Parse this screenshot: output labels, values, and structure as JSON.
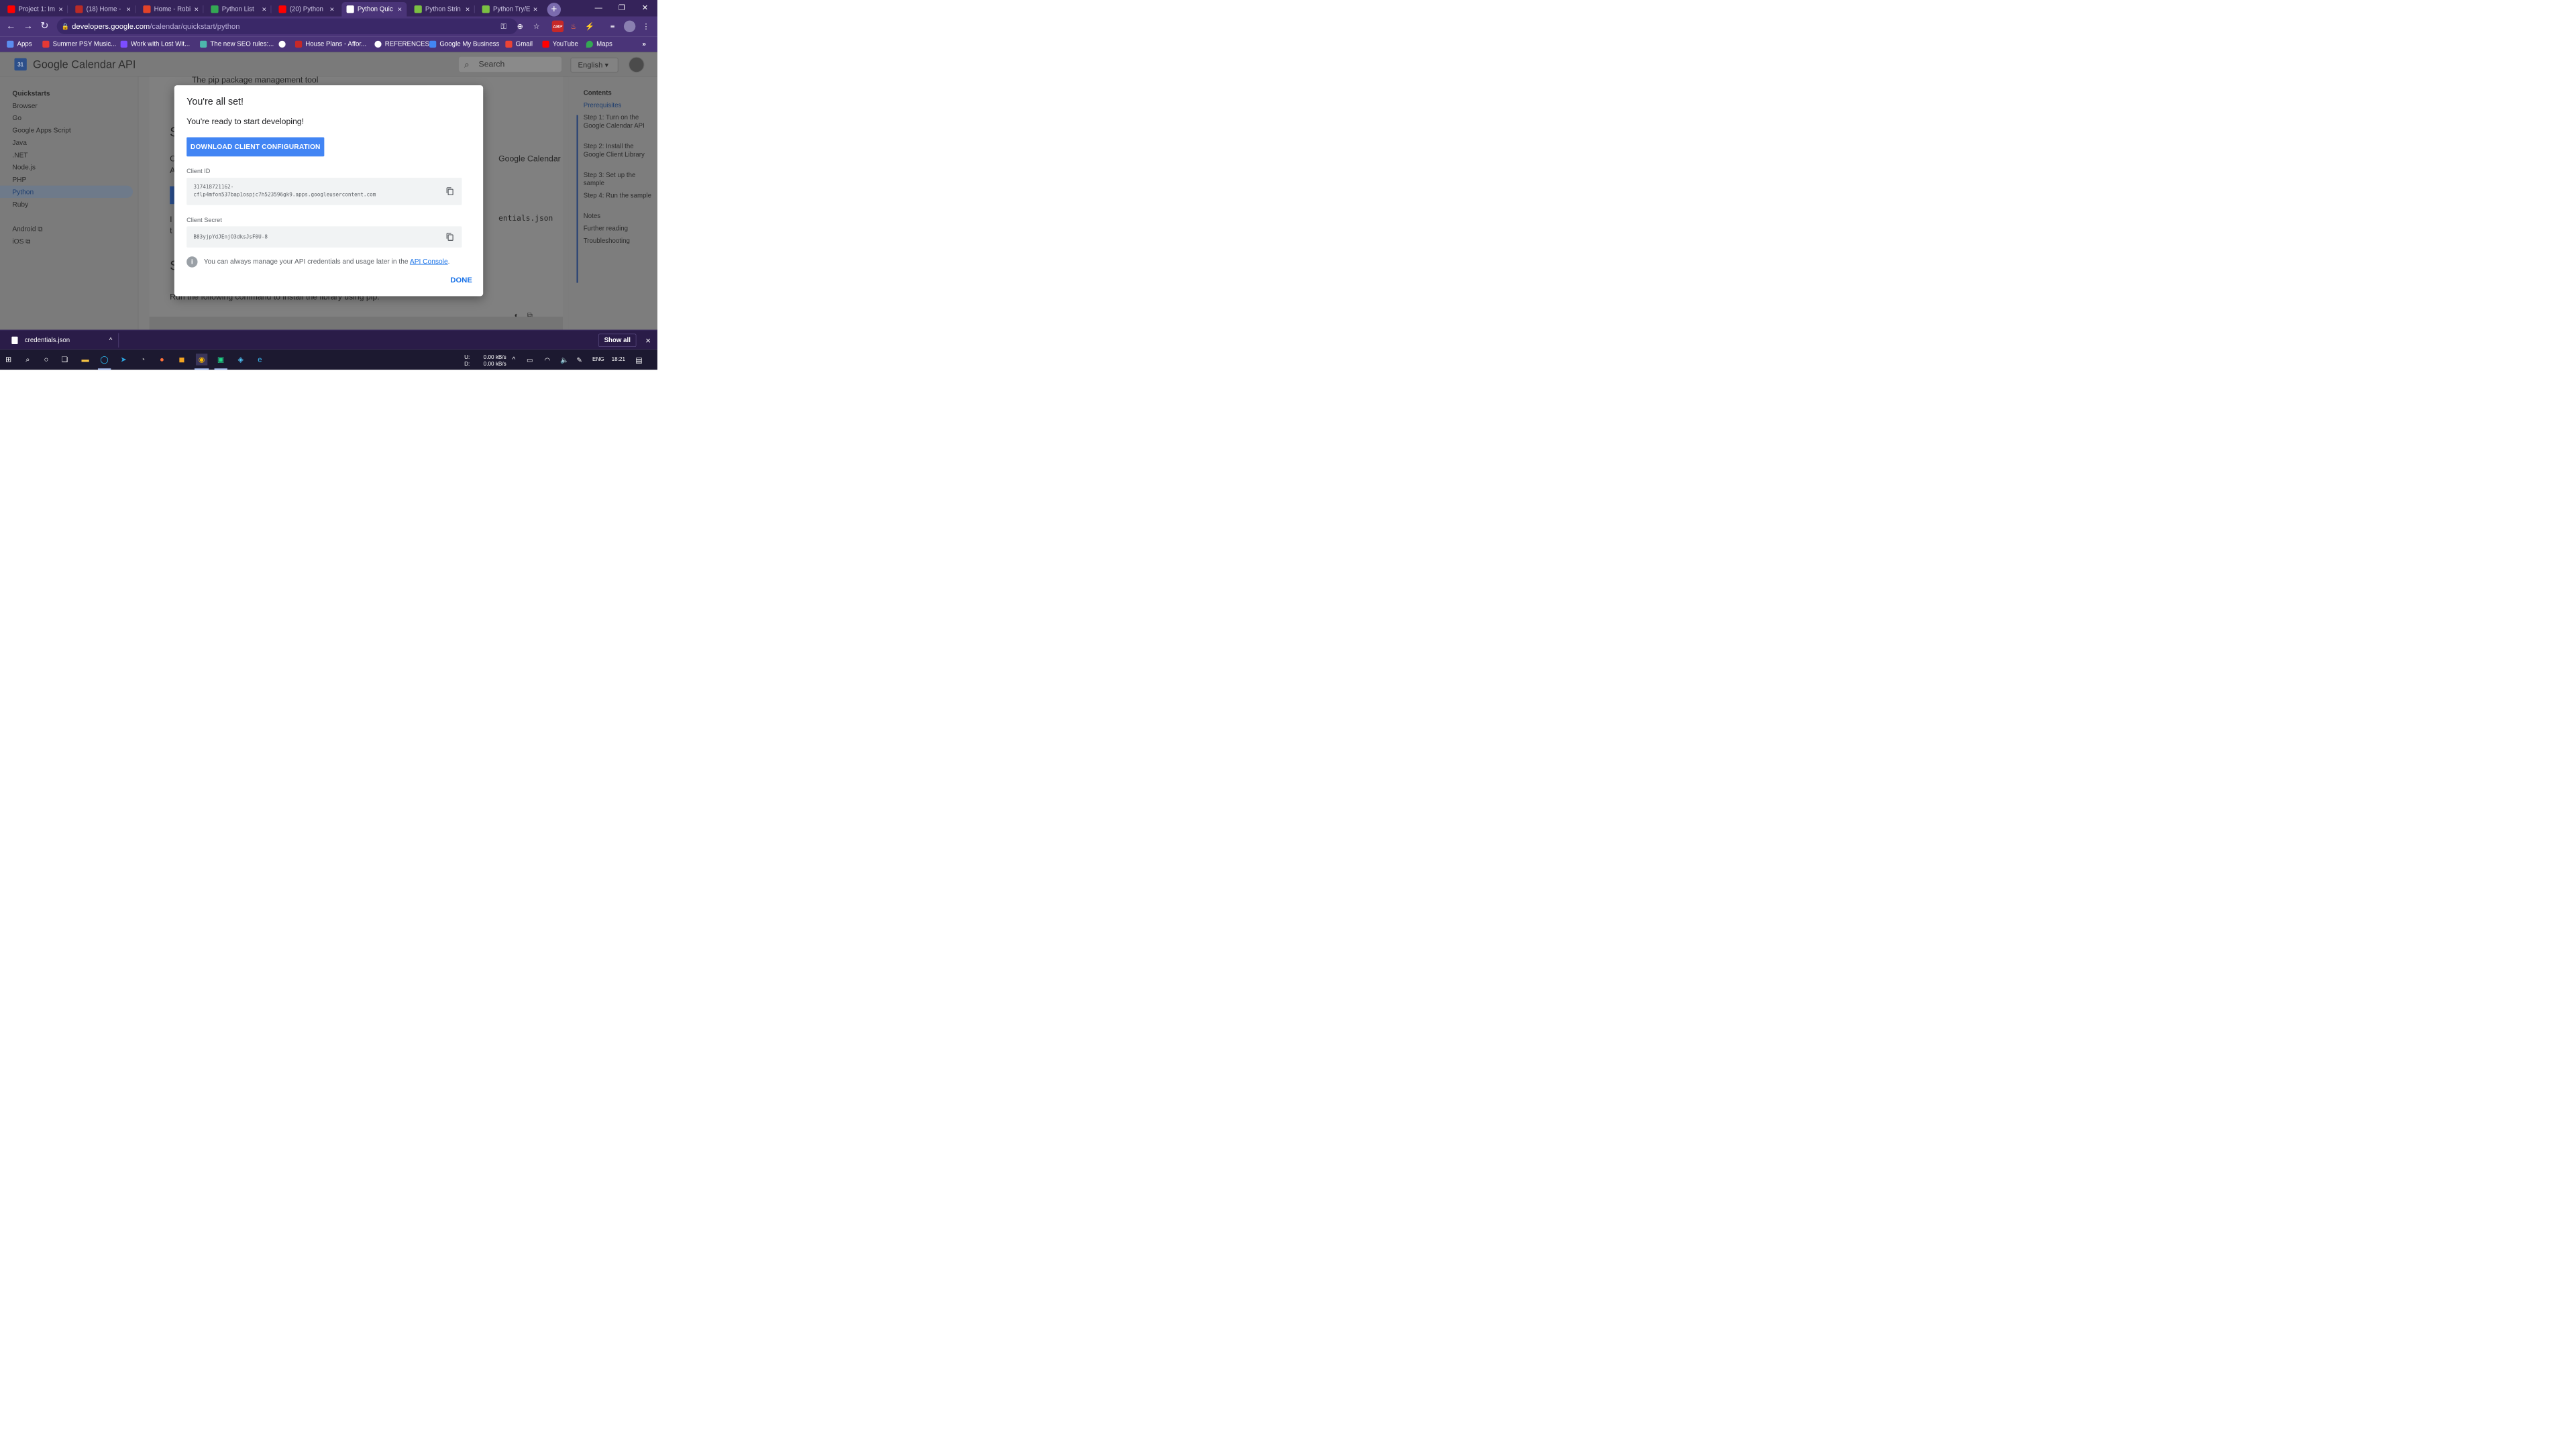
{
  "browser": {
    "tabs": [
      {
        "label": "Project 1: Im",
        "favicon_color": "#ff0000"
      },
      {
        "label": "(18) Home -",
        "favicon_color": "#b92b27"
      },
      {
        "label": "Home - Robi",
        "favicon_color": "#e24329"
      },
      {
        "label": "Python List",
        "favicon_color": "#34a853"
      },
      {
        "label": "(20) Python",
        "favicon_color": "#ff0000"
      },
      {
        "label": "Python Quic",
        "favicon_color": "#ffffff"
      },
      {
        "label": "Python Strin",
        "favicon_color": "#7bc043"
      },
      {
        "label": "Python Try/E",
        "favicon_color": "#7bc043"
      }
    ],
    "url_host": "developers.google.com",
    "url_path": "/calendar/quickstart/python",
    "bookmarks": [
      "Apps",
      "Summer PSY Music...",
      "Work with Lost Wit...",
      "The new SEO rules:...",
      "",
      "House Plans - Affor...",
      "REFERENCES",
      "Google My Business",
      "Gmail",
      "YouTube",
      "Maps"
    ]
  },
  "site": {
    "title": "Google Calendar API",
    "search_placeholder": "Search",
    "language": "English"
  },
  "leftnav": {
    "heading": "Quickstarts",
    "items": [
      "Browser",
      "Go",
      "Google Apps Script",
      "Java",
      ".NET",
      "Node.js",
      "PHP",
      "Python",
      "Ruby"
    ],
    "active": "Python",
    "external": [
      "Android",
      "iOS"
    ]
  },
  "content": {
    "pip_line": "The pip package management tool",
    "gcal_fragment": "Google Calendar",
    "credentials_fragment": "entials.json",
    "install_line": "Run the following command to install the library using pip:"
  },
  "toc": {
    "heading": "Contents",
    "items": [
      "Prerequisites",
      "Step 1: Turn on the Google Calendar API",
      "Step 2: Install the Google Client Library",
      "Step 3: Set up the sample",
      "Step 4: Run the sample",
      "Notes",
      "Further reading",
      "Troubleshooting"
    ],
    "active": "Prerequisites"
  },
  "modal": {
    "title": "You're all set!",
    "subtitle": "You're ready to start developing!",
    "download_label": "DOWNLOAD CLIENT CONFIGURATION",
    "client_id_label": "Client ID",
    "client_id_line1": "317418721162-",
    "client_id_line2": "cflp4mfon537bap1ospjc7h523596gk9.apps.googleusercontent.com",
    "client_secret_label": "Client Secret",
    "client_secret": "B83yjpYdJEnjO3dksJsF0U-8",
    "info_text": "You can always manage your API credentials and usage later in the ",
    "info_link": "API Console",
    "info_end": ".",
    "done_label": "DONE"
  },
  "downloads": {
    "file": "credentials.json",
    "show_all": "Show all"
  },
  "taskbar": {
    "net_up_label": "U:",
    "net_down_label": "D:",
    "net_up": "0.00 kB/s",
    "net_down": "0.00 kB/s",
    "lang": "ENG",
    "time": "18:21"
  }
}
